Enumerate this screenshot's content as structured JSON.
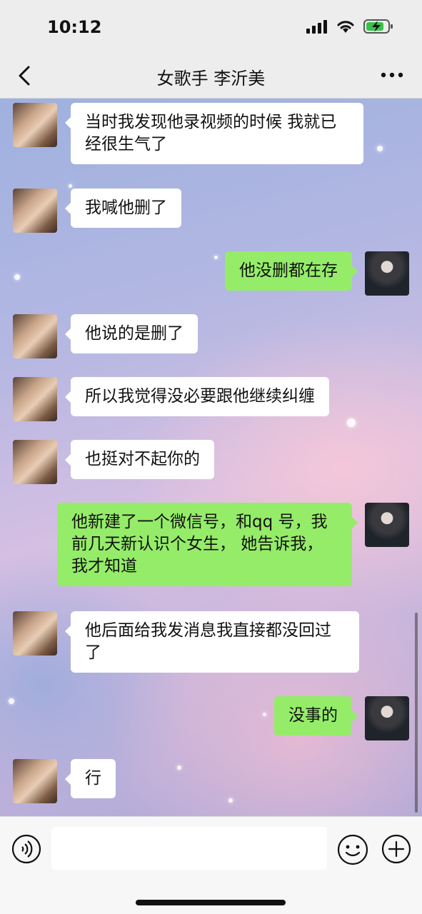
{
  "status_bar": {
    "time": "10:12"
  },
  "header": {
    "title": "女歌手 李沂美"
  },
  "messages": [
    {
      "side": "left",
      "text": "当时我发现他录视频的时候 我就已经很生气了"
    },
    {
      "side": "left",
      "text": "我喊他删了"
    },
    {
      "side": "right",
      "text": "他没删都在存"
    },
    {
      "side": "left",
      "text": "他说的是删了"
    },
    {
      "side": "left",
      "text": "所以我觉得没必要跟他继续纠缠"
    },
    {
      "side": "left",
      "text": "也挺对不起你的"
    },
    {
      "side": "right",
      "text": "他新建了一个微信号，和qq 号，我前几天新认识个女生， 她告诉我，我才知道"
    },
    {
      "side": "left",
      "text": "他后面给我发消息我直接都没回过了"
    },
    {
      "side": "right",
      "text": "没事的"
    },
    {
      "side": "left",
      "text": "行"
    }
  ],
  "input": {
    "value": ""
  },
  "colors": {
    "sent_bubble": "#95ec69",
    "received_bubble": "#ffffff",
    "bar_background": "#ededed"
  },
  "icons": {
    "back": "chevron-left-icon",
    "more": "more-dots-icon",
    "voice": "voice-icon",
    "emoji": "emoji-icon",
    "plus": "plus-icon"
  }
}
